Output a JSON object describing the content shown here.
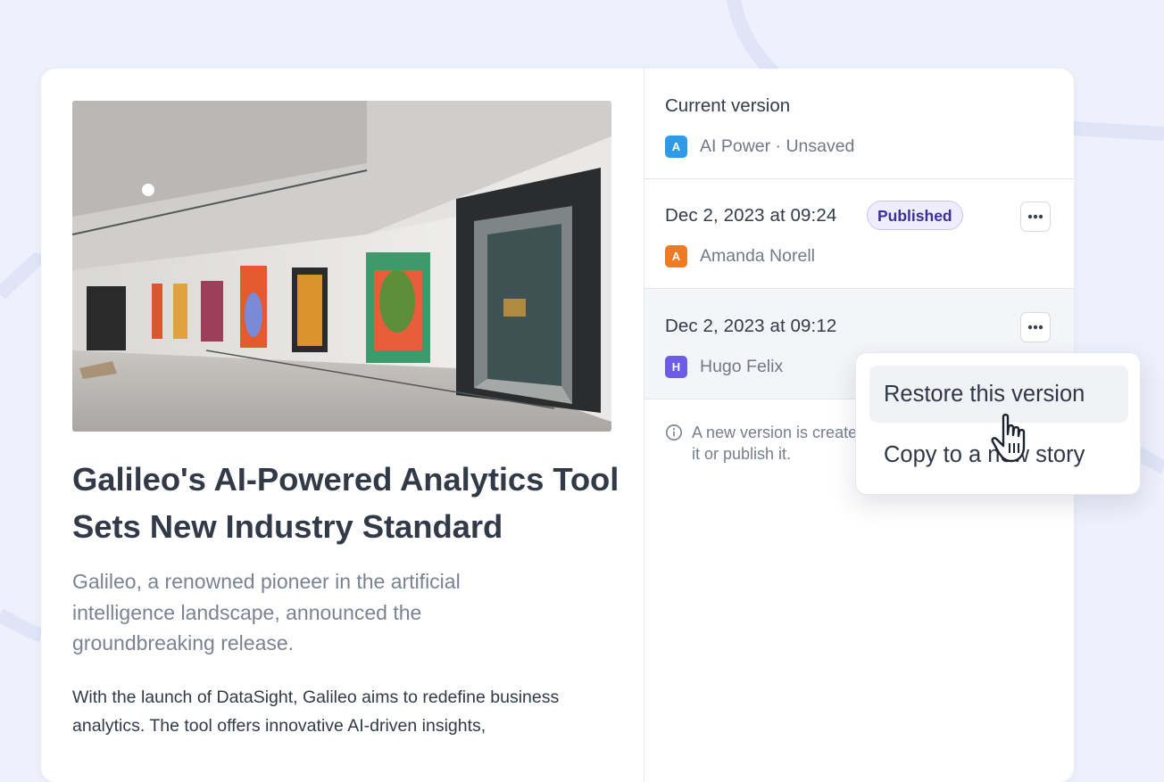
{
  "article": {
    "image_alt": "Art gallery with colorful paintings",
    "title": "Galileo's AI-Powered Analytics Tool Sets New Industry Standard",
    "subtitle": "Galileo, a renowned pioneer in the artificial intelligence landscape, announced the groundbreaking release.",
    "body": "With the launch of DataSight, Galileo aims to redefine business analytics. The tool offers innovative AI-driven insights,"
  },
  "versions": {
    "current": {
      "heading": "Current version",
      "author_initial": "A",
      "author_label": "AI Power · Unsaved",
      "avatar_color": "#2f9ae8"
    },
    "items": [
      {
        "date": "Dec 2, 2023 at 09:24",
        "badge": "Published",
        "author_initial": "A",
        "author": "Amanda Norell",
        "avatar_color": "#f07a22"
      },
      {
        "date": "Dec 2, 2023 at 09:12",
        "author_initial": "H",
        "author": "Hugo Felix",
        "avatar_color": "#6c5ce6"
      }
    ],
    "info_text": "A new version is created when you manually save it or publish it."
  },
  "menu": {
    "items": [
      "Restore this version",
      "Copy to a new story"
    ]
  },
  "icons": {
    "more": "more-horizontal-icon",
    "info": "info-icon",
    "cursor": "hand-pointer-cursor"
  }
}
